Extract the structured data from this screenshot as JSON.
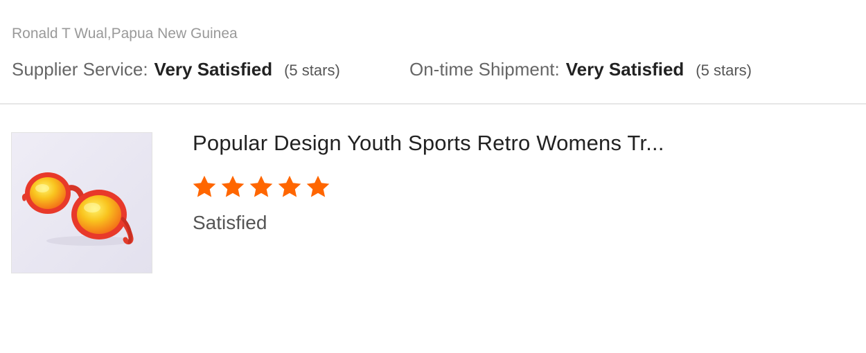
{
  "review": {
    "reviewer": "Ronald T Wual,Papua New Guinea",
    "supplier_service": {
      "label": "Supplier Service:",
      "value": "Very Satisfied",
      "stars_text": "(5 stars)"
    },
    "ontime_shipment": {
      "label": "On-time Shipment:",
      "value": "Very Satisfied",
      "stars_text": "(5 stars)"
    }
  },
  "product": {
    "title": "Popular Design Youth Sports Retro Womens Tr...",
    "rating": 5,
    "rating_max": 5,
    "feedback": "Satisfied",
    "image_icon": "sunglasses-product-image"
  },
  "colors": {
    "star": "#ff6600",
    "frame": "#e8392a",
    "lens": "#f8c21c"
  }
}
